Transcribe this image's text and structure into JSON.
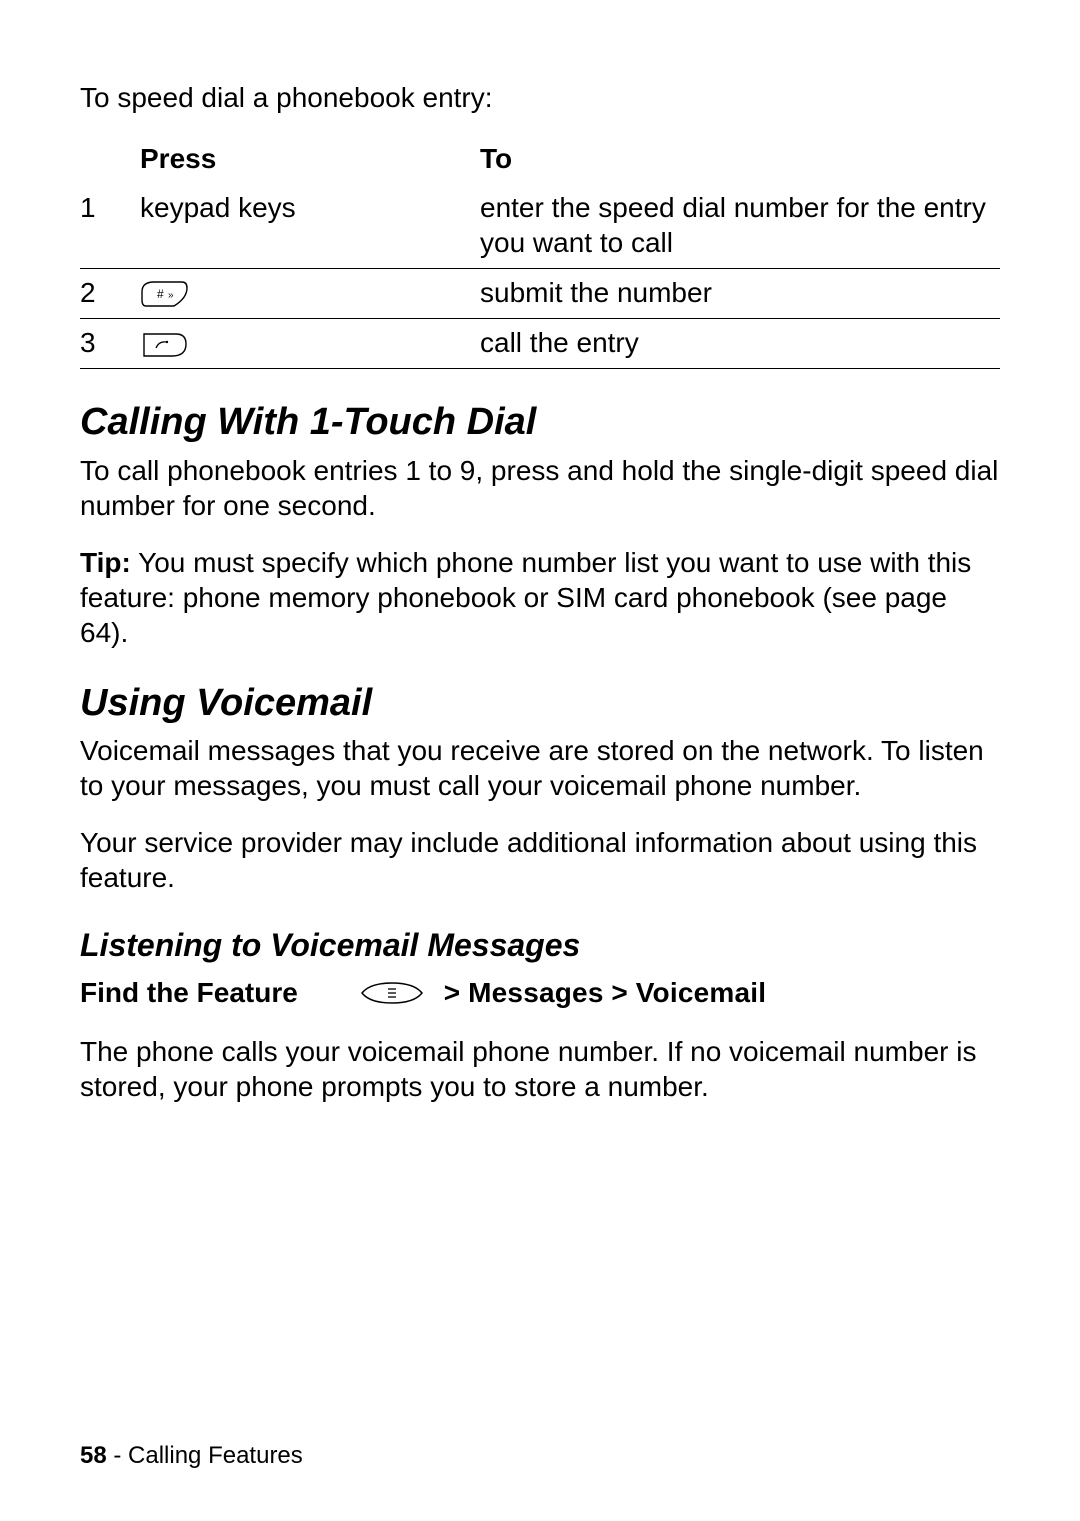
{
  "intro": "To speed dial a phonebook entry:",
  "table": {
    "head_press": "Press",
    "head_to": "To",
    "rows": [
      {
        "num": "1",
        "press": "keypad keys",
        "icon": null,
        "to": "enter the speed dial number for the entry you want to call"
      },
      {
        "num": "2",
        "press": "",
        "icon": "hash-key",
        "to": "submit the number"
      },
      {
        "num": "3",
        "press": "",
        "icon": "send-key",
        "to": "call the entry"
      }
    ]
  },
  "sec1": {
    "title": "Calling With 1-Touch Dial",
    "p1": "To call phonebook entries 1 to 9, press and hold the single-digit speed dial number for one second.",
    "tip_label": "Tip:",
    "tip_text": " You must specify which phone number list you want to use with this feature: phone memory phonebook or SIM card phonebook (see page 64)."
  },
  "sec2": {
    "title": "Using Voicemail",
    "p1": "Voicemail messages that you receive are stored on the network. To listen to your messages, you must call your voicemail phone number.",
    "p2": "Your service provider may include additional information about using this feature."
  },
  "sec3": {
    "title": "Listening to Voicemail Messages",
    "feature_label": "Find the Feature",
    "nav_sep1": ">",
    "nav_item1": "Messages",
    "nav_sep2": ">",
    "nav_item2": "Voicemail",
    "p1": "The phone calls your voicemail phone number. If no voicemail number is stored, your phone prompts you to store a number."
  },
  "footer": {
    "page": "58",
    "sep": " - ",
    "section": "Calling Features"
  }
}
